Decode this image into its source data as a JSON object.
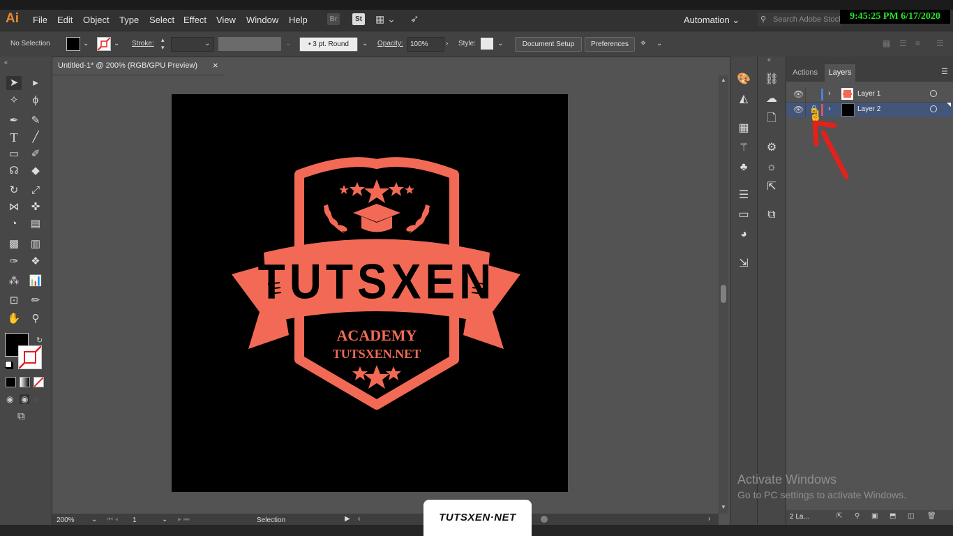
{
  "app": {
    "logo": "Ai"
  },
  "menubar": {
    "items": [
      "File",
      "Edit",
      "Object",
      "Type",
      "Select",
      "Effect",
      "View",
      "Window",
      "Help"
    ],
    "bridge_label": "Br",
    "stock_label": "St",
    "workspace": "Automation",
    "search_placeholder": "Search Adobe Stock",
    "clock": "9:45:25 PM 6/17/2020"
  },
  "controlbar": {
    "selection": "No Selection",
    "stroke_label": "Stroke:",
    "brush": "3 pt. Round",
    "opacity_label": "Opacity:",
    "opacity_value": "100%",
    "style_label": "Style:",
    "document_setup": "Document Setup",
    "preferences": "Preferences"
  },
  "document": {
    "tab_title": "Untitled-1* @ 200% (RGB/GPU Preview)",
    "close": "×"
  },
  "artwork": {
    "title": "TUTSXEN",
    "line1": "ACADEMY",
    "line2": "TUTSXEN.NET",
    "color": "#f26a55",
    "background": "#000000"
  },
  "statusbar": {
    "zoom": "200%",
    "artboard": "1",
    "tool": "Selection"
  },
  "layers_panel": {
    "tabs": [
      "Actions",
      "Layers"
    ],
    "active_tab": "Layers",
    "layers": [
      {
        "name": "Layer 1",
        "color": "#4f7fd9",
        "locked": false,
        "selected": false
      },
      {
        "name": "Layer 2",
        "color": "#e05252",
        "locked": true,
        "selected": true
      }
    ],
    "footer_count": "2 La..."
  },
  "watermark": {
    "title": "Activate Windows",
    "subtitle": "Go to PC settings to activate Windows."
  },
  "overlay": {
    "badge": "TUTSXEN·NET"
  },
  "colors": {
    "accent_red": "#e3211b",
    "clock_green": "#29e629"
  }
}
